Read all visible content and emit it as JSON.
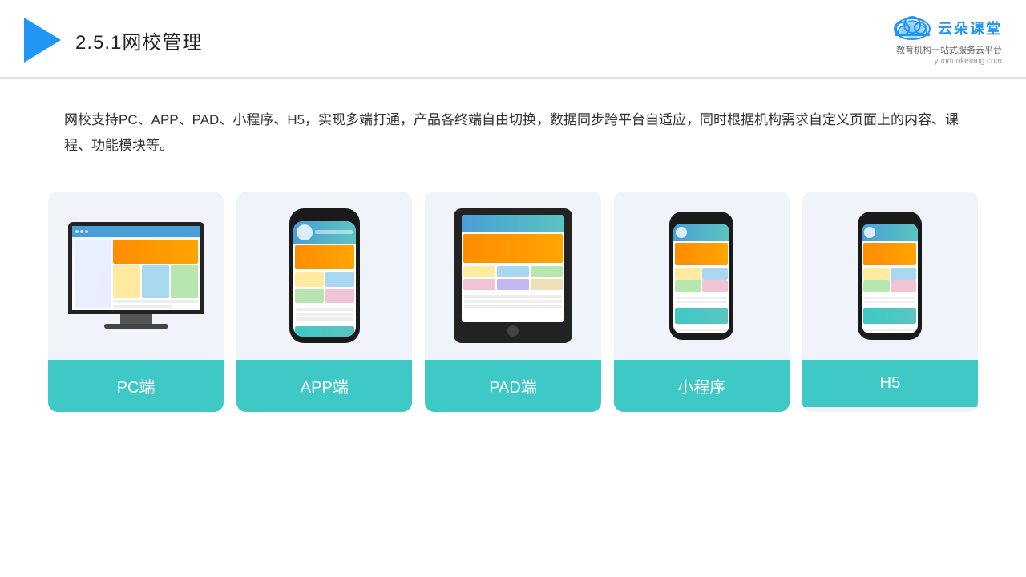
{
  "header": {
    "title_prefix": "2.5.1",
    "title_main": "网校管理",
    "logo_text": "云朵课堂",
    "logo_url": "yunduoketang.com",
    "logo_subtitle": "教育机构一站\n式服务云平台"
  },
  "description": {
    "text": "网校支持PC、APP、PAD、小程序、H5，实现多端打通，产品各终端自由切换，数据同步跨平台自适应，同时根据机构需求自定义页面上的内容、课程、功能模块等。"
  },
  "cards": [
    {
      "id": "pc",
      "label": "PC端"
    },
    {
      "id": "app",
      "label": "APP端"
    },
    {
      "id": "pad",
      "label": "PAD端"
    },
    {
      "id": "miniprogram",
      "label": "小程序"
    },
    {
      "id": "h5",
      "label": "H5"
    }
  ],
  "colors": {
    "accent": "#3FC9C6",
    "header_border": "#e0e0e0",
    "triangle": "#2196F3",
    "logo_blue": "#2196F3"
  }
}
